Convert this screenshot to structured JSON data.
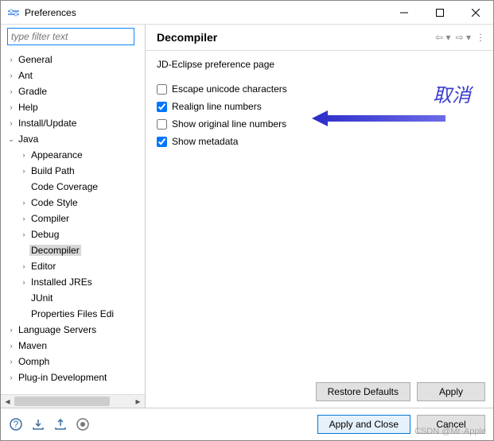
{
  "window": {
    "title": "Preferences"
  },
  "filter": {
    "placeholder": "type filter text"
  },
  "tree": {
    "items": [
      {
        "label": "General",
        "depth": 0,
        "expanded": false,
        "hasChildren": true,
        "selected": false
      },
      {
        "label": "Ant",
        "depth": 0,
        "expanded": false,
        "hasChildren": true,
        "selected": false
      },
      {
        "label": "Gradle",
        "depth": 0,
        "expanded": false,
        "hasChildren": true,
        "selected": false
      },
      {
        "label": "Help",
        "depth": 0,
        "expanded": false,
        "hasChildren": true,
        "selected": false
      },
      {
        "label": "Install/Update",
        "depth": 0,
        "expanded": false,
        "hasChildren": true,
        "selected": false
      },
      {
        "label": "Java",
        "depth": 0,
        "expanded": true,
        "hasChildren": true,
        "selected": false
      },
      {
        "label": "Appearance",
        "depth": 1,
        "expanded": false,
        "hasChildren": true,
        "selected": false
      },
      {
        "label": "Build Path",
        "depth": 1,
        "expanded": false,
        "hasChildren": true,
        "selected": false
      },
      {
        "label": "Code Coverage",
        "depth": 1,
        "expanded": false,
        "hasChildren": false,
        "selected": false
      },
      {
        "label": "Code Style",
        "depth": 1,
        "expanded": false,
        "hasChildren": true,
        "selected": false
      },
      {
        "label": "Compiler",
        "depth": 1,
        "expanded": false,
        "hasChildren": true,
        "selected": false
      },
      {
        "label": "Debug",
        "depth": 1,
        "expanded": false,
        "hasChildren": true,
        "selected": false
      },
      {
        "label": "Decompiler",
        "depth": 1,
        "expanded": false,
        "hasChildren": false,
        "selected": true
      },
      {
        "label": "Editor",
        "depth": 1,
        "expanded": false,
        "hasChildren": true,
        "selected": false
      },
      {
        "label": "Installed JREs",
        "depth": 1,
        "expanded": false,
        "hasChildren": true,
        "selected": false
      },
      {
        "label": "JUnit",
        "depth": 1,
        "expanded": false,
        "hasChildren": false,
        "selected": false
      },
      {
        "label": "Properties Files Edi",
        "depth": 1,
        "expanded": false,
        "hasChildren": false,
        "selected": false
      },
      {
        "label": "Language Servers",
        "depth": 0,
        "expanded": false,
        "hasChildren": true,
        "selected": false
      },
      {
        "label": "Maven",
        "depth": 0,
        "expanded": false,
        "hasChildren": true,
        "selected": false
      },
      {
        "label": "Oomph",
        "depth": 0,
        "expanded": false,
        "hasChildren": true,
        "selected": false
      },
      {
        "label": "Plug-in Development",
        "depth": 0,
        "expanded": false,
        "hasChildren": true,
        "selected": false
      }
    ]
  },
  "page": {
    "title": "Decompiler",
    "description": "JD-Eclipse preference page",
    "options": [
      {
        "label": "Escape unicode characters",
        "checked": false
      },
      {
        "label": "Realign line numbers",
        "checked": true
      },
      {
        "label": "Show original line numbers",
        "checked": false
      },
      {
        "label": "Show metadata",
        "checked": true
      }
    ]
  },
  "annotation": {
    "text": "取消"
  },
  "buttons": {
    "restore_defaults": "Restore Defaults",
    "apply": "Apply",
    "apply_close": "Apply and Close",
    "cancel": "Cancel"
  },
  "watermark": "CSDN @Mr·Apple"
}
